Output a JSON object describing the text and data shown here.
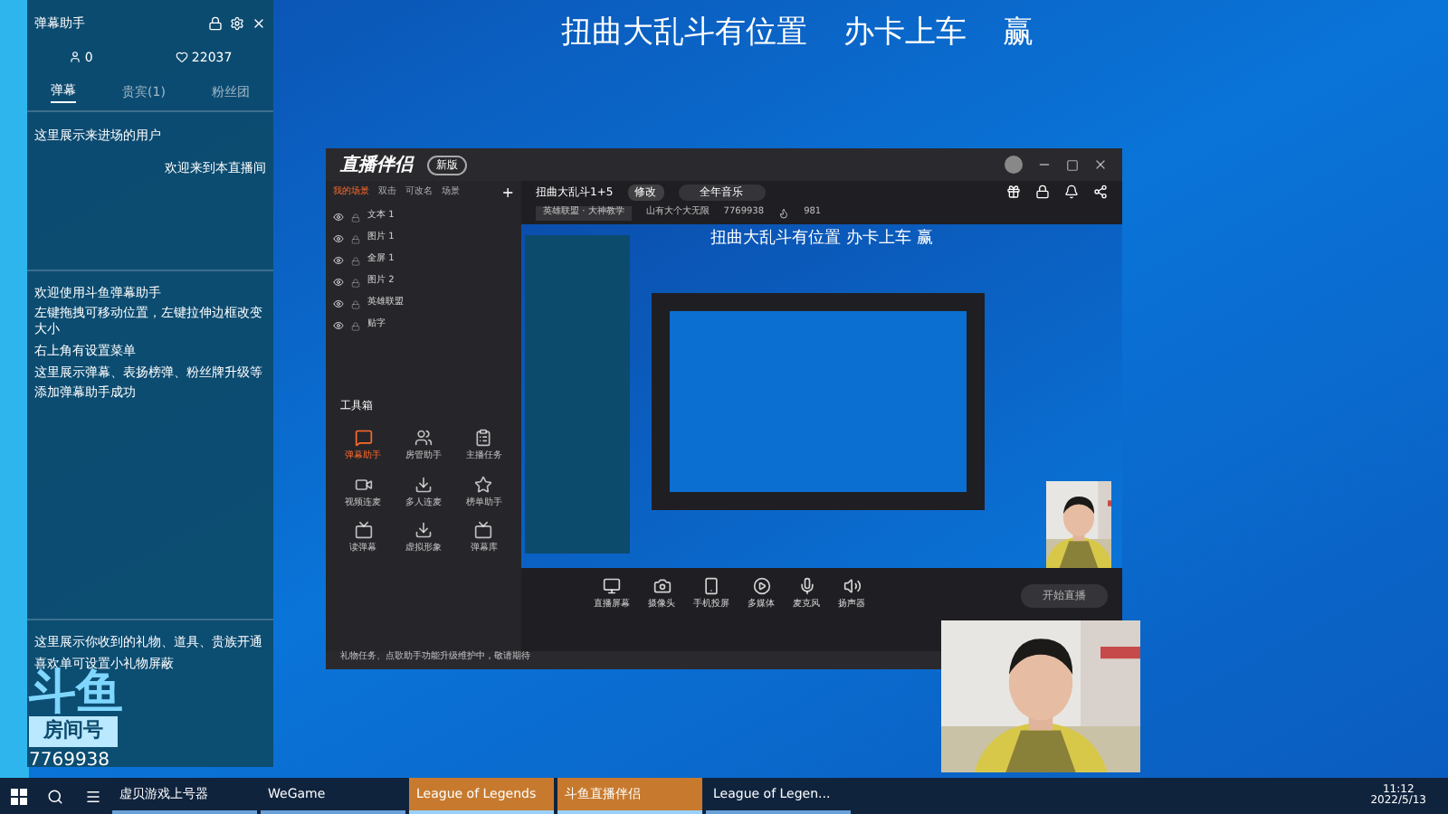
{
  "headline": [
    "扭曲大乱斗有位置",
    "办卡上车",
    "赢"
  ],
  "danmu_panel": {
    "title": "弹幕助手",
    "stats": [
      "0",
      "22037"
    ],
    "tabs": [
      {
        "label": "弹幕",
        "selected": true
      },
      {
        "label": "贵宾(1)",
        "selected": false
      },
      {
        "label": "粉丝团",
        "selected": false
      }
    ],
    "notice": "这里展示来进场的用户",
    "welcome": "欢迎来到本直播间",
    "help_lines": [
      "欢迎使用斗鱼弹幕助手",
      "左键拖拽可移动位置，左键拉伸边框改变大小",
      "右上角有设置菜单",
      "这里展示弹幕、表扬榜弹、粉丝牌升级等",
      "添加弹幕助手成功"
    ],
    "gift_lines": [
      "这里展示你收到的礼物、道具、贵族开通",
      "喜欢单可设置小礼物屏蔽"
    ]
  },
  "app": {
    "logo": "直播伴侣",
    "badge": "新版",
    "scene_tabs": [
      {
        "label": "我的场景",
        "selected": true
      },
      {
        "label": "双击",
        "selected": false
      },
      {
        "label": "可改名",
        "selected": false
      },
      {
        "label": "场景",
        "selected": false
      }
    ],
    "add": "+",
    "room_title": "扭曲大乱斗1+5",
    "edit": "修改",
    "music": "全年音乐",
    "category": "英雄联盟 · 大神教学",
    "owner": "山有大个大无限",
    "room_id": "7769938",
    "heat": "981",
    "sources": [
      {
        "label": "文本 1",
        "visible": true
      },
      {
        "label": "图片 1",
        "visible": true
      },
      {
        "label": "全屏 1",
        "visible": true
      },
      {
        "label": "图片 2",
        "visible": true
      },
      {
        "label": "英雄联盟",
        "visible": true
      },
      {
        "label": "贴字",
        "visible": true
      }
    ],
    "toolbox_title": "工具箱",
    "tools": [
      {
        "label": "弹幕助手",
        "selected": true
      },
      {
        "label": "房管助手",
        "selected": false
      },
      {
        "label": "主播任务",
        "selected": false
      },
      {
        "label": "视频连麦",
        "selected": false
      },
      {
        "label": "多人连麦",
        "selected": false
      },
      {
        "label": "榜单助手",
        "selected": false
      },
      {
        "label": "读弹幕",
        "selected": false
      },
      {
        "label": "虚拟形象",
        "selected": false
      },
      {
        "label": "弹幕库",
        "selected": false
      }
    ],
    "preview_caption": "扭曲大乱斗有位置  办卡上车  赢",
    "controls": [
      "直播屏幕",
      "摄像头",
      "手机投屏",
      "多媒体",
      "麦克风",
      "扬声器"
    ],
    "start": "开始直播",
    "status": "礼物任务、点歌助手功能升级维护中，敬请期待"
  },
  "room": {
    "logo": "斗鱼",
    "label": "房间号",
    "number": "7769938"
  },
  "taskbar": {
    "items": [
      {
        "label": "虚贝游戏上号器",
        "active": false
      },
      {
        "label": "WeGame",
        "active": false
      },
      {
        "label": "League of Legends",
        "active": true
      },
      {
        "label": "斗鱼直播伴侣",
        "active": true
      },
      {
        "label": "League of Legen...",
        "active": false
      }
    ],
    "time": "11:12",
    "date": "2022/5/13"
  }
}
